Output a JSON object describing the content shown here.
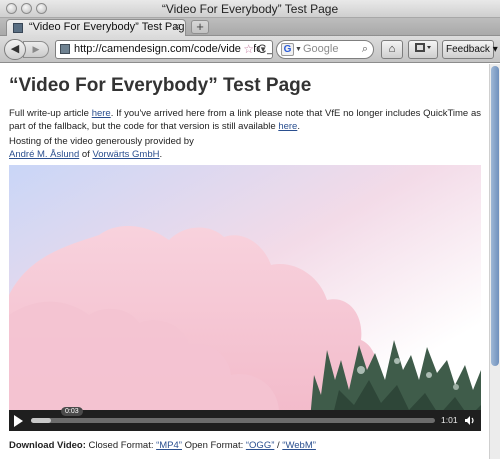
{
  "window": {
    "title": "“Video For Everybody” Test Page"
  },
  "tabs": [
    {
      "label": "“Video For Everybody” Test Page",
      "close": "×"
    }
  ],
  "newtab_label": "+",
  "toolbar": {
    "back": "◀",
    "forward": "▶",
    "url": "http://camendesign.com/code/video_for_everybody/test.html",
    "bookmark": "☆",
    "url_dropdown": "▼",
    "reload": "C",
    "search_placeholder": "Google",
    "search_engine_icon": "G",
    "search_dd": "▼",
    "search_go": "⌕",
    "home": "⌂",
    "feedback_label": "Feedback ▾"
  },
  "page": {
    "title": "“Video For Everybody” Test Page",
    "p1_a": "Full write-up article ",
    "p1_link": "here",
    "p1_b": ". If you've arrived here from a link please note that VfE no longer includes QuickTime as part of the fallback, but the code for that version is still available ",
    "p1_link2": "here",
    "p1_c": ".",
    "p2_a": "Hosting of the video generously provided by",
    "p2_link1": "André M. Åslund",
    "p2_b": " of ",
    "p2_link2": "Vorwärts GmbH",
    "p2_c": "."
  },
  "video": {
    "current_time": "0:03",
    "duration": "1:01",
    "progress": 0.05,
    "play_icon": "play-icon",
    "volume_icon": "volume-icon"
  },
  "download": {
    "label": "Download Video:",
    "closed_label": " Closed Format: ",
    "mp4": "“MP4”",
    "open_label": " Open Format: ",
    "ogg": "“OGG”",
    "sep": " / ",
    "webm": "“WebM”"
  }
}
